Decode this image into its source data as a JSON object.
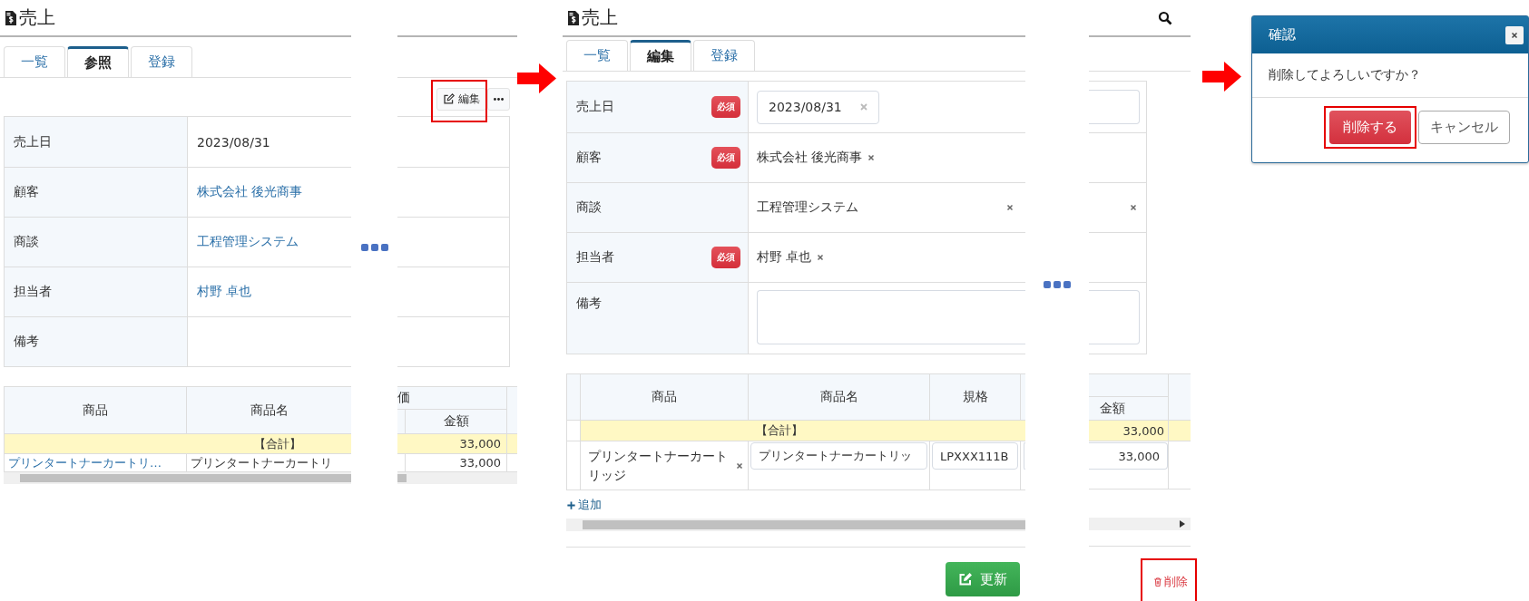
{
  "panels": [
    {
      "kind": "view",
      "title": "売上",
      "tabs": [
        {
          "label": "一覧",
          "selected": false
        },
        {
          "label": "参照",
          "selected": true
        },
        {
          "label": "登録",
          "selected": false
        }
      ],
      "edit_button": {
        "label": "編集",
        "highlighted": true
      },
      "fields": [
        {
          "label": "売上日",
          "value": "2023/08/31",
          "link": false
        },
        {
          "label": "顧客",
          "value": "株式会社 後光商事",
          "link": true
        },
        {
          "label": "商談",
          "value": "工程管理システム",
          "link": true
        },
        {
          "label": "担当者",
          "value": "村野 卓也",
          "link": true
        },
        {
          "label": "備考"
        }
      ],
      "lines": {
        "columns": [
          "商品",
          "商品名"
        ],
        "column_3": "価",
        "column_4": "金額",
        "total": {
          "label": "【合計】",
          "amount": "33,000"
        },
        "rows": [
          {
            "product": "プリンタートナーカートリ…",
            "product_name": "プリンタートナーカートリ",
            "amount": "33,000"
          }
        ]
      }
    },
    {
      "kind": "edit",
      "title": "売上",
      "tabs": [
        {
          "label": "一覧",
          "selected": false
        },
        {
          "label": "編集",
          "selected": true
        },
        {
          "label": "登録",
          "selected": false
        }
      ],
      "fields": [
        {
          "label": "売上日",
          "badge": "必須",
          "kind": "date",
          "value": "2023/08/31"
        },
        {
          "label": "顧客",
          "badge": "必須",
          "kind": "select",
          "value": "株式会社 後光商事"
        },
        {
          "label": "商談",
          "kind": "select_wide",
          "value": "工程管理システム"
        },
        {
          "label": "担当者",
          "badge": "必須",
          "kind": "select",
          "value": "村野 卓也"
        },
        {
          "label": "備考",
          "kind": "textarea"
        }
      ],
      "lines": {
        "columns": [
          "商品",
          "商品名",
          "規格"
        ],
        "column_5": "金額",
        "total": {
          "label": "【合計】",
          "amount": "33,000"
        },
        "rows": [
          {
            "product": "プリンタートナーカートリッジ",
            "product_name": "プリンタートナーカートリッ",
            "spec": "LPXXX111B",
            "amount": "33,000"
          }
        ]
      },
      "add_link": "追加",
      "update_button": "更新",
      "delete_link": {
        "label": "削除",
        "highlighted": true
      }
    }
  ],
  "dialog": {
    "title": "確認",
    "message": "削除してよろしいですか？",
    "confirm_button": {
      "label": "削除する",
      "highlighted": true
    },
    "cancel_button": "キャンセル"
  }
}
